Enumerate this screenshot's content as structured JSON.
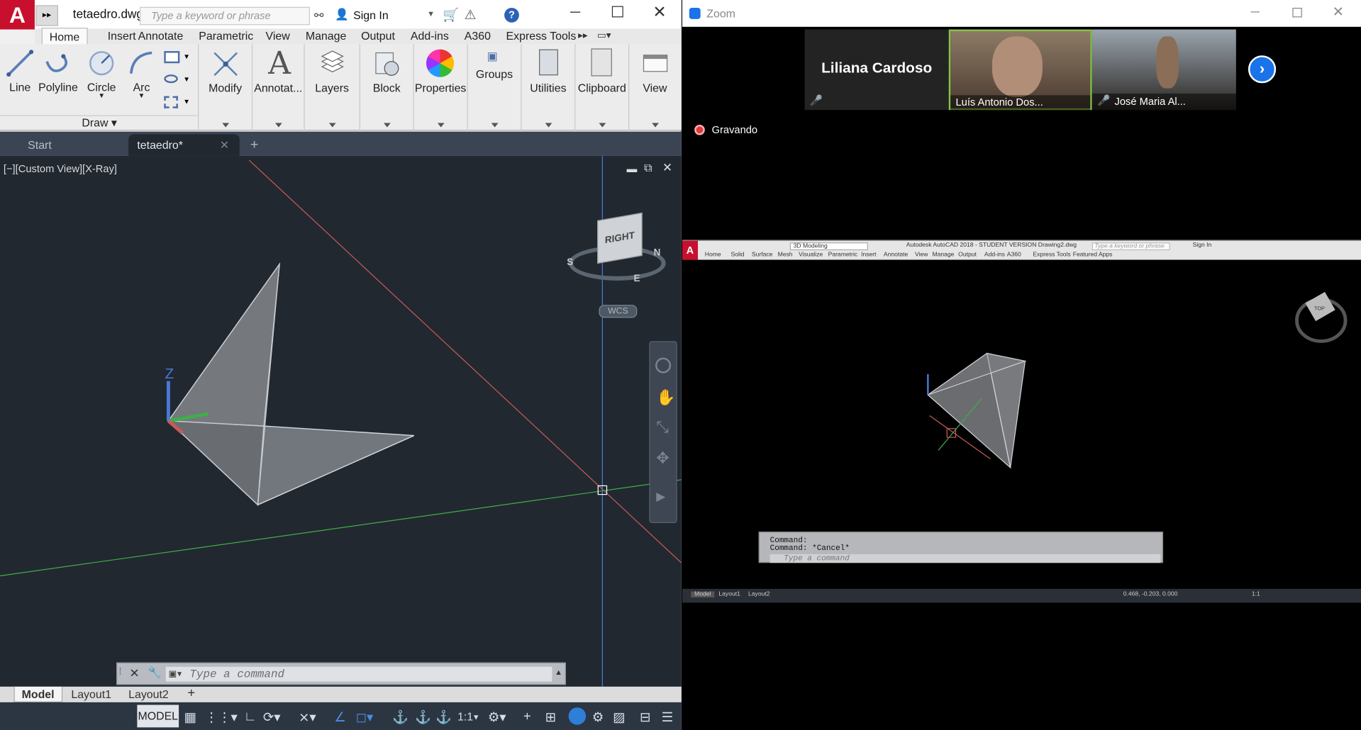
{
  "acad": {
    "logo": "A",
    "filename": "tetaedro.dwg",
    "search_placeholder": "Type a keyword or phrase",
    "signin": "Sign In",
    "help_glyph": "?",
    "tabs": [
      "Home",
      "Insert",
      "Annotate",
      "Parametric",
      "View",
      "Manage",
      "Output",
      "Add-ins",
      "A360",
      "Express Tools"
    ],
    "draw_tools": [
      "Line",
      "Polyline",
      "Circle",
      "Arc"
    ],
    "draw_panel": "Draw",
    "panels": [
      "Modify",
      "Annotat...",
      "Layers",
      "Block",
      "Properties",
      "Groups",
      "Utilities",
      "Clipboard",
      "View"
    ],
    "doc_tabs": {
      "start": "Start",
      "active": "tetaedro*"
    },
    "viewport_label": "[−][Custom View][X-Ray]",
    "viewcube": {
      "face": "RIGHT",
      "compass": [
        "S",
        "E",
        "N"
      ],
      "wcs": "WCS"
    },
    "ucs_z": "Z",
    "cmd_placeholder": "Type a command",
    "layout_tabs": [
      "Model",
      "Layout1",
      "Layout2"
    ],
    "status_model": "MODEL",
    "status_scale": "1:1"
  },
  "zoom": {
    "title": "Zoom",
    "participants": [
      {
        "name": "Liliana Cardoso",
        "muted": true
      },
      {
        "name": "Luís Antonio Dos...",
        "muted": false
      },
      {
        "name": "José Maria Al...",
        "muted": true
      }
    ],
    "recording": "Gravando",
    "shared": {
      "workspace": "3D Modeling",
      "app_title": "Autodesk AutoCAD 2018 - STUDENT VERSION    Drawing2.dwg",
      "search": "Type a keyword or phrase",
      "signin": "Sign In",
      "tabs": [
        "Home",
        "Solid",
        "Surface",
        "Mesh",
        "Visualize",
        "Parametric",
        "Insert",
        "Annotate",
        "View",
        "Manage",
        "Output",
        "Add-ins",
        "A360",
        "Express Tools",
        "Featured Apps"
      ],
      "cube": "TOP",
      "cmd_lines": [
        "Command:",
        "Command: *Cancel*"
      ],
      "cmd_placeholder": "Type a command",
      "layout_tabs": [
        "Model",
        "Layout1",
        "Layout2"
      ],
      "coords": "0.468, -0.203, 0.000",
      "scale": "1:1"
    }
  },
  "colors": {
    "acad_red": "#c8102e",
    "viewport_bg": "#212830",
    "axis_red": "#c85a5a",
    "axis_green": "#3fae49",
    "axis_blue": "#4b78d8",
    "zoom_blue": "#1a73e8",
    "rec_red": "#e03a3a"
  }
}
